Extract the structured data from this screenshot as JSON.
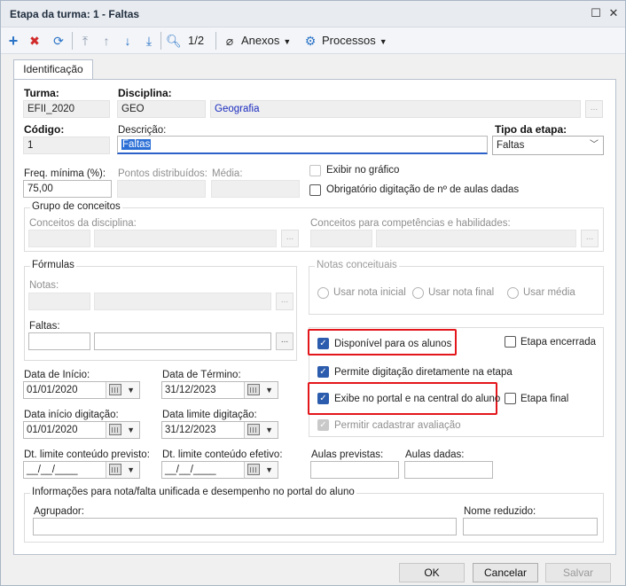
{
  "window": {
    "title": "Etapa da turma: 1 - Faltas"
  },
  "toolbar": {
    "page_indicator": "1/2",
    "anexos_label": "Anexos",
    "processos_label": "Processos"
  },
  "tabs": [
    {
      "label": "Identificação"
    }
  ],
  "form": {
    "turma_label": "Turma:",
    "turma_value": "EFII_2020",
    "disciplina_label": "Disciplina:",
    "disciplina_code": "GEO",
    "disciplina_name": "Geografia",
    "codigo_label": "Código:",
    "codigo_value": "1",
    "descricao_label": "Descrição:",
    "descricao_value": "Faltas",
    "tipo_etapa_label": "Tipo da etapa:",
    "tipo_etapa_value": "Faltas",
    "freq_minima_label": "Freq. mínima (%):",
    "freq_minima_value": "75,00",
    "pontos_label": "Pontos distribuídos:",
    "media_label": "Média:",
    "exibir_grafico_label": "Exibir no gráfico",
    "obrigatorio_label": "Obrigatório digitação de nº de aulas dadas",
    "grupo_conceitos_label": "Grupo de conceitos",
    "conceitos_disciplina_label": "Conceitos da disciplina:",
    "conceitos_competencias_label": "Conceitos para competências e habilidades:",
    "formulas_label": "Fórmulas",
    "notas_label": "Notas:",
    "faltas_label": "Faltas:",
    "notas_conceituais_label": "Notas conceituais",
    "usar_nota_inicial_label": "Usar nota inicial",
    "usar_nota_final_label": "Usar nota final",
    "usar_media_label": "Usar média",
    "disponivel_alunos_label": "Disponível para os alunos",
    "etapa_encerrada_label": "Etapa encerrada",
    "permite_digitacao_label": "Permite digitação diretamente na etapa",
    "exibe_portal_label": "Exibe no portal e na central do aluno",
    "etapa_final_label": "Etapa final",
    "permitir_cadastrar_label": "Permitir cadastrar avaliação",
    "data_inicio_label": "Data de Início:",
    "data_inicio_value": "01/01/2020",
    "data_termino_label": "Data de Término:",
    "data_termino_value": "31/12/2023",
    "data_inicio_dig_label": "Data início digitação:",
    "data_inicio_dig_value": "01/01/2020",
    "data_limite_dig_label": "Data limite digitação:",
    "data_limite_dig_value": "31/12/2023",
    "dt_limite_previsto_label": "Dt. limite conteúdo previsto:",
    "dt_limite_previsto_value": "__/__/____",
    "dt_limite_efetivo_label": "Dt. limite conteúdo efetivo:",
    "dt_limite_efetivo_value": "__/__/____",
    "aulas_previstas_label": "Aulas previstas:",
    "aulas_dadas_label": "Aulas dadas:",
    "info_group_label": "Informações para nota/falta unificada e desempenho no portal do aluno",
    "agrupador_label": "Agrupador:",
    "nome_reduzido_label": "Nome reduzido:"
  },
  "buttons": {
    "ok": "OK",
    "cancelar": "Cancelar",
    "salvar": "Salvar"
  },
  "colors": {
    "highlight": "#e3161b",
    "accent": "#2c5cad",
    "link_blue": "#1a2bbf"
  }
}
